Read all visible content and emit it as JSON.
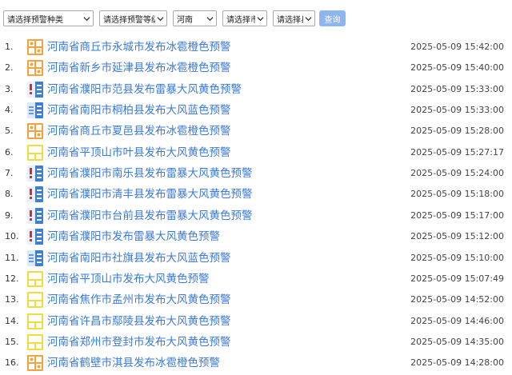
{
  "filters": {
    "type": "请选择预警种类",
    "level": "请选择预警等级",
    "province": "河南",
    "city": "请选择市",
    "county": "请选择县",
    "query_button": "查询"
  },
  "alerts": [
    {
      "index": "1.",
      "title": "河南省商丘市永城市发布冰雹橙色预警",
      "time": "2025-05-09 15:42:00",
      "icon": "hail-orange-icon"
    },
    {
      "index": "2.",
      "title": "河南省新乡市延津县发布冰雹橙色预警",
      "time": "2025-05-09 15:40:00",
      "icon": "hail-orange-icon"
    },
    {
      "index": "3.",
      "title": "河南省濮阳市范县发布雷暴大风黄色预警",
      "time": "2025-05-09 15:33:00",
      "icon": "thunder-wind-yellow-icon"
    },
    {
      "index": "4.",
      "title": "河南省南阳市桐柏县发布大风蓝色预警",
      "time": "2025-05-09 15:33:00",
      "icon": "wind-blue-icon"
    },
    {
      "index": "5.",
      "title": "河南省商丘市夏邑县发布冰雹橙色预警",
      "time": "2025-05-09 15:28:00",
      "icon": "hail-orange-icon"
    },
    {
      "index": "6.",
      "title": "河南省平顶山市叶县发布大风黄色预警",
      "time": "2025-05-09 15:27:17",
      "icon": "wind-yellow-icon"
    },
    {
      "index": "7.",
      "title": "河南省濮阳市南乐县发布雷暴大风黄色预警",
      "time": "2025-05-09 15:24:00",
      "icon": "thunder-wind-yellow-icon"
    },
    {
      "index": "8.",
      "title": "河南省濮阳市清丰县发布雷暴大风黄色预警",
      "time": "2025-05-09 15:18:00",
      "icon": "thunder-wind-yellow-icon"
    },
    {
      "index": "9.",
      "title": "河南省濮阳市台前县发布雷暴大风黄色预警",
      "time": "2025-05-09 15:17:00",
      "icon": "thunder-wind-yellow-icon"
    },
    {
      "index": "10.",
      "title": "河南省濮阳市发布雷暴大风黄色预警",
      "time": "2025-05-09 15:12:00",
      "icon": "thunder-wind-yellow-icon"
    },
    {
      "index": "11.",
      "title": "河南省南阳市社旗县发布大风蓝色预警",
      "time": "2025-05-09 15:10:00",
      "icon": "wind-blue-icon"
    },
    {
      "index": "12.",
      "title": "河南省平顶山市发布大风黄色预警",
      "time": "2025-05-09 15:07:49",
      "icon": "wind-yellow-icon"
    },
    {
      "index": "13.",
      "title": "河南省焦作市孟州市发布大风黄色预警",
      "time": "2025-05-09 14:52:00",
      "icon": "wind-yellow-icon"
    },
    {
      "index": "14.",
      "title": "河南省许昌市鄢陵县发布大风黄色预警",
      "time": "2025-05-09 14:46:00",
      "icon": "wind-yellow-icon"
    },
    {
      "index": "15.",
      "title": "河南省郑州市登封市发布大风黄色预警",
      "time": "2025-05-09 14:35:00",
      "icon": "wind-yellow-icon"
    },
    {
      "index": "16.",
      "title": "河南省鹤壁市淇县发布冰雹橙色预警",
      "time": "2025-05-09 14:28:00",
      "icon": "hail-orange-icon"
    }
  ],
  "colors": {
    "link": "#3a7ad9",
    "button": "#8cb6f0",
    "orange": "#f5a23c",
    "yellow": "#f2dc3c",
    "blue": "#3d7fd4"
  }
}
